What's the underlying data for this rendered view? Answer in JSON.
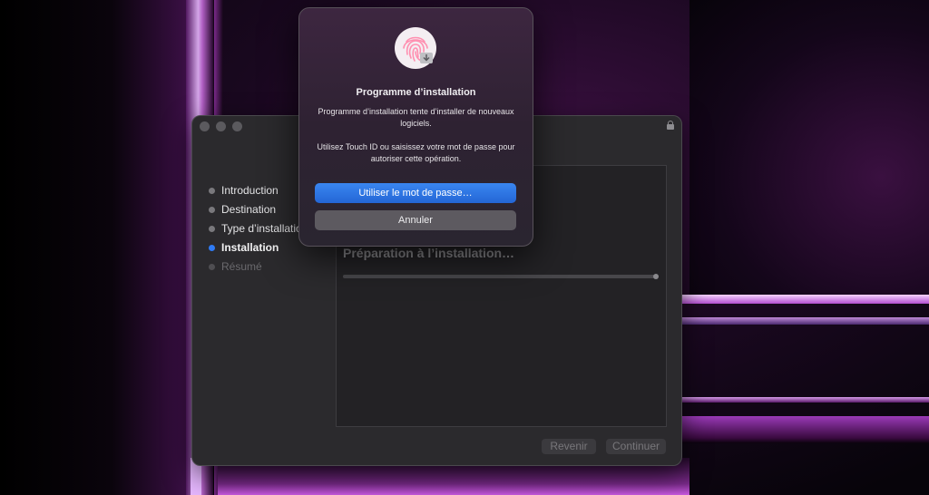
{
  "installer": {
    "steps": [
      {
        "label": "Introduction",
        "state": "done"
      },
      {
        "label": "Destination",
        "state": "done"
      },
      {
        "label": "Type d’installation",
        "state": "done"
      },
      {
        "label": "Installation",
        "state": "active"
      },
      {
        "label": "Résumé",
        "state": "pending"
      }
    ],
    "status_text": "Préparation à l’installation…",
    "back_label": "Revenir",
    "continue_label": "Continuer"
  },
  "dialog": {
    "icon": "touch-id-fingerprint-icon",
    "title": "Programme d’installation",
    "message": "Programme d’installation tente d’installer de nouveaux logiciels.",
    "instruction": "Utilisez Touch ID ou saisissez votre mot de passe pour autoriser cette opération.",
    "primary_label": "Utiliser le mot de passe…",
    "cancel_label": "Annuler"
  },
  "colors": {
    "accent": "#2f7bf5",
    "primary_button": "#2f72e2",
    "fingerprint": "#ff8fb0"
  }
}
